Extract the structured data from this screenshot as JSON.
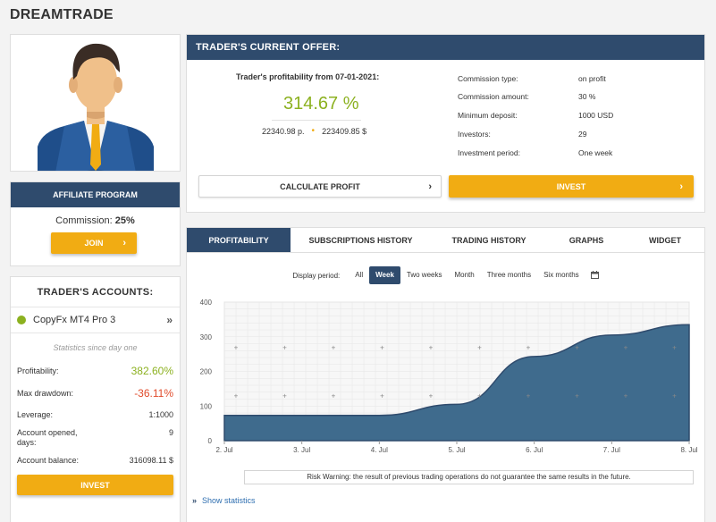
{
  "brand": "DREAMTRADE",
  "colors": {
    "primary": "#2f4b6d",
    "accent": "#f1ac13",
    "green": "#8cb120",
    "red": "#e04b2b",
    "chart_fill": "#3f6b8d"
  },
  "affiliate": {
    "title": "AFFILIATE PROGRAM",
    "commission_label": "Commission:",
    "commission_value": "25%",
    "join_label": "JOIN"
  },
  "accounts": {
    "title": "TRADER'S ACCOUNTS:",
    "account_name": "CopyFx MT4 Pro 3",
    "stats_since": "Statistics since day one",
    "stats": [
      {
        "label": "Profitability:",
        "value": "382.60%"
      },
      {
        "label": "Max drawdown:",
        "value": "-36.11%"
      },
      {
        "label": "Leverage:",
        "value": "1:1000"
      },
      {
        "label": "Account opened, days:",
        "value": "9"
      },
      {
        "label": "Account balance:",
        "value": "316098.11 $"
      }
    ],
    "invest_label": "INVEST"
  },
  "offer": {
    "title": "TRADER'S CURRENT OFFER:",
    "profitability_label": "Trader's profitability from 07-01-2021:",
    "profitability_value": "314.67 %",
    "amount_rub": "22340.98 р.",
    "amount_usd": "223409.85 $",
    "specs": [
      {
        "label": "Commission type:",
        "value": "on profit"
      },
      {
        "label": "Commission amount:",
        "value": "30 %"
      },
      {
        "label": "Minimum deposit:",
        "value": "1000 USD"
      },
      {
        "label": "Investors:",
        "value": "29"
      },
      {
        "label": "Investment period:",
        "value": "One week"
      }
    ],
    "calc_label": "CALCULATE PROFIT",
    "invest_label": "INVEST"
  },
  "tabs": [
    {
      "label": "PROFITABILITY",
      "active": true
    },
    {
      "label": "SUBSCRIPTIONS HISTORY",
      "active": false
    },
    {
      "label": "TRADING HISTORY",
      "active": false
    },
    {
      "label": "GRAPHS",
      "active": false
    },
    {
      "label": "WIDGET",
      "active": false
    }
  ],
  "period": {
    "label": "Display period:",
    "options": [
      {
        "label": "All",
        "active": false
      },
      {
        "label": "Week",
        "active": true
      },
      {
        "label": "Two weeks",
        "active": false
      },
      {
        "label": "Month",
        "active": false
      },
      {
        "label": "Three months",
        "active": false
      },
      {
        "label": "Six months",
        "active": false
      }
    ]
  },
  "chart_data": {
    "type": "area",
    "x": [
      "2. Jul",
      "3. Jul",
      "4. Jul",
      "5. Jul",
      "6. Jul",
      "7. Jul",
      "8. Jul"
    ],
    "values": [
      73,
      73,
      73,
      105,
      243,
      305,
      335
    ],
    "ylim": [
      0,
      400
    ],
    "yticks": [
      0,
      100,
      200,
      300,
      400
    ],
    "grid": true,
    "xlabel": "",
    "ylabel": ""
  },
  "risk_warning": "Risk Warning: the result of previous trading operations do not guarantee the same results in the future.",
  "show_statistics": "Show statistics"
}
